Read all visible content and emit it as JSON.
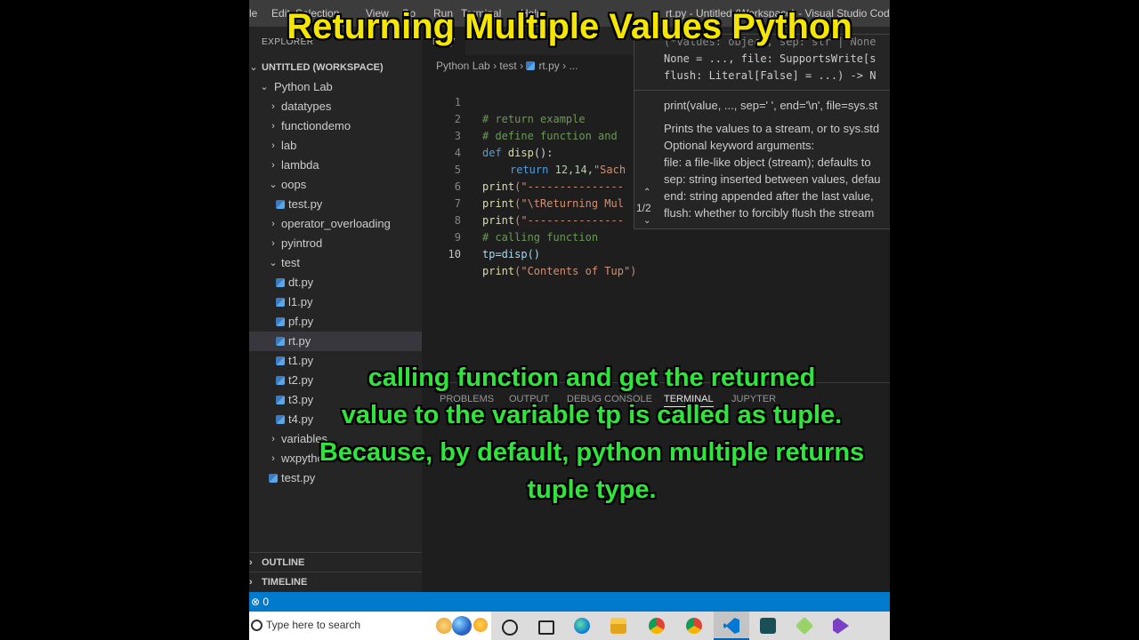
{
  "titlebar": {
    "menu": [
      "le",
      "Edit",
      "Selection",
      "View",
      "Go",
      "Run",
      "Terminal",
      "Help"
    ],
    "window_title": "rt.py - Untitled (Workspace) - Visual Studio Code"
  },
  "sidebar": {
    "explorer_label": "EXPLORER",
    "workspace": "UNTITLED (WORKSPACE)",
    "root_folder": "Python Lab",
    "items": [
      {
        "label": "datatypes",
        "kind": "folder",
        "open": false
      },
      {
        "label": "functiondemo",
        "kind": "folder",
        "open": false
      },
      {
        "label": "lab",
        "kind": "folder",
        "open": false
      },
      {
        "label": "lambda",
        "kind": "folder",
        "open": false
      },
      {
        "label": "oops",
        "kind": "folder",
        "open": true
      },
      {
        "label": "test.py",
        "kind": "file",
        "depth": 2
      },
      {
        "label": "operator_overloading",
        "kind": "folder",
        "open": false
      },
      {
        "label": "pyintrod",
        "kind": "folder",
        "open": false
      },
      {
        "label": "test",
        "kind": "folder",
        "open": true
      },
      {
        "label": "dt.py",
        "kind": "file",
        "depth": 2
      },
      {
        "label": "l1.py",
        "kind": "file",
        "depth": 2
      },
      {
        "label": "pf.py",
        "kind": "file",
        "depth": 2
      },
      {
        "label": "rt.py",
        "kind": "file",
        "depth": 2,
        "selected": true
      },
      {
        "label": "t1.py",
        "kind": "file",
        "depth": 2
      },
      {
        "label": "t2.py",
        "kind": "file",
        "depth": 2
      },
      {
        "label": "t3.py",
        "kind": "file",
        "depth": 2
      },
      {
        "label": "t4.py",
        "kind": "file",
        "depth": 2
      },
      {
        "label": "variables",
        "kind": "folder",
        "open": false
      },
      {
        "label": "wxpython",
        "kind": "folder",
        "open": false
      },
      {
        "label": "test.py",
        "kind": "file",
        "depth": 1
      }
    ],
    "outline": "OUTLINE",
    "timeline": "TIMELINE"
  },
  "editor": {
    "tab": "rt.py",
    "breadcrumb": [
      "Python Lab",
      "test",
      "rt.py",
      "..."
    ],
    "lines": [
      {
        "n": "1",
        "text": "# return example",
        "type": "comment"
      },
      {
        "n": "2",
        "text": "# define function and",
        "type": "comment"
      },
      {
        "n": "3",
        "kw": "def",
        "fn": "disp",
        "rest": "():",
        "type": "def"
      },
      {
        "n": "4",
        "kw": "return",
        "nums": "12,14,",
        "str": "\"Sach",
        "type": "return"
      },
      {
        "n": "5",
        "fn": "print",
        "str": "(\"---------------",
        "type": "print"
      },
      {
        "n": "6",
        "fn": "print",
        "str": "(\"\\tReturning Mul",
        "type": "print"
      },
      {
        "n": "7",
        "fn": "print",
        "str": "(\"---------------",
        "type": "print"
      },
      {
        "n": "8",
        "text": "# calling function",
        "type": "comment"
      },
      {
        "n": "9",
        "text": "tp=disp()",
        "type": "plain"
      },
      {
        "n": "10",
        "fn": "print",
        "str": "(\"Contents of Tup\")",
        "type": "print"
      }
    ]
  },
  "hover": {
    "sig_lines": [
      "None = ..., file: SupportsWrite[s",
      "flush: Literal[False] = ...) -> N"
    ],
    "sig_top": "(*values: object, sep: str | None",
    "summary": "print(value, ..., sep=' ', end='\\n', file=sys.st",
    "doc_lines": [
      "Prints the values to a stream, or to sys.std",
      "Optional keyword arguments:",
      "file: a file-like object (stream); defaults to",
      "sep: string inserted between values, defau",
      "end: string appended after the last value,",
      "flush: whether to forcibly flush the stream"
    ],
    "pager": "1/2"
  },
  "panel": {
    "tabs": [
      "PROBLEMS",
      "OUTPUT",
      "DEBUG CONSOLE",
      "TERMINAL",
      "JUPYTER"
    ],
    "active": "TERMINAL"
  },
  "statusbar": {
    "text": "⊗ 0"
  },
  "taskbar": {
    "search_placeholder": "Type here to search"
  },
  "overlay": {
    "title": "Returning Multiple Values Python",
    "caption_lines": [
      "calling function and get the returned",
      "value to the variable tp is called as tuple.",
      "Because, by default, python multiple returns",
      "tuple type."
    ]
  },
  "colors": {
    "accent": "#007acc",
    "title_overlay": "#f5e600",
    "caption_overlay": "#2ee53b"
  }
}
